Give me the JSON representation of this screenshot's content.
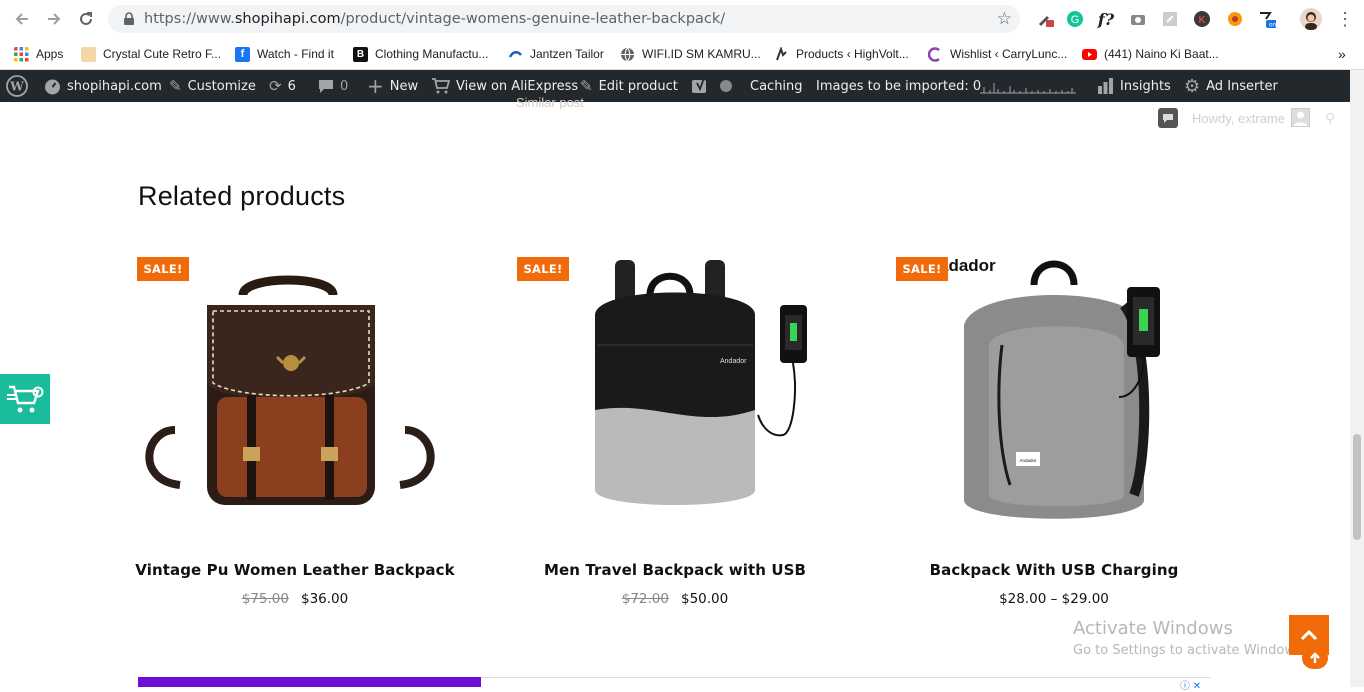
{
  "browser": {
    "url_prefix": "https://www.",
    "url_host": "shopihapi.com",
    "url_path": "/product/vintage-womens-genuine-leather-backpack/",
    "bookmarks": [
      {
        "label": "Apps",
        "icon": "apps-grid-icon"
      },
      {
        "label": "Crystal Cute Retro F...",
        "icon": "handshake-icon"
      },
      {
        "label": "Watch - Find it",
        "icon": "facebook-icon"
      },
      {
        "label": "Clothing Manufactu...",
        "icon": "b-logo-icon"
      },
      {
        "label": "Jantzen Tailor",
        "icon": "jantzen-icon"
      },
      {
        "label": "WIFI.ID SM KAMRU...",
        "icon": "globe-icon"
      },
      {
        "label": "Products ‹ HighVolt...",
        "icon": "hv-icon"
      },
      {
        "label": "Wishlist ‹ CarryLunc...",
        "icon": "carrylunch-icon"
      },
      {
        "label": "(441) Naino Ki Baat...",
        "icon": "youtube-icon"
      }
    ],
    "bookmarks_more": "»"
  },
  "adminbar": {
    "site": "shopihapi.com",
    "customize": "Customize",
    "updates_count": "6",
    "comments_count": "0",
    "new": "New",
    "view_aliexpress": "View on AliExpress",
    "edit_product": "Edit product",
    "caching": "Caching",
    "images_import": "Images to be imported: 0",
    "insights": "Insights",
    "ad_inserter": "Ad Inserter",
    "howdy": "Howdy, extrame"
  },
  "page": {
    "similar_post": "Similar post",
    "related_title": "Related products",
    "products": [
      {
        "name": "Vintage Pu Women Leather Backpack",
        "old_price": "$75.00",
        "price": "$36.00",
        "badge": "SALE!"
      },
      {
        "name": "Men Travel Backpack with USB",
        "old_price": "$72.00",
        "price": "$50.00",
        "badge": "SALE!"
      },
      {
        "name": "Backpack With USB Charging",
        "old_price": "",
        "price": "$28.00 – $29.00",
        "badge": "SALE!"
      }
    ],
    "img3_brand": "adador",
    "img2_brand": "Andador",
    "img3_patch": "Andador"
  },
  "watermark": {
    "line1": "Activate Windows",
    "line2": "Go to Settings to activate Windows."
  },
  "colors": {
    "sale": "#f16b0a",
    "adminbar": "#23282d",
    "widget": "#1bbc9b",
    "ad_purple": "#6f0fd6"
  }
}
